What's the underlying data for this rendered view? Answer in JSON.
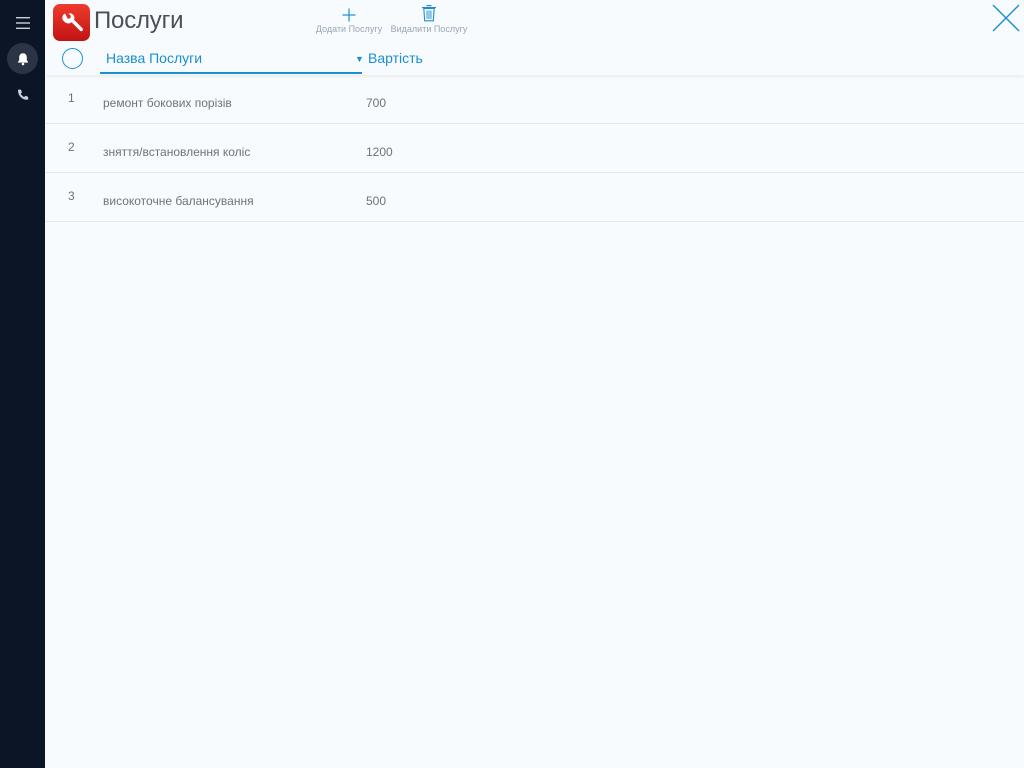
{
  "sidebar": {
    "items": [
      {
        "icon": "menu-icon"
      },
      {
        "icon": "bell-icon",
        "active": true
      },
      {
        "icon": "phone-icon"
      }
    ]
  },
  "header": {
    "app_icon": "wrench-icon",
    "title": "Послуги",
    "add_label": "Додати Послугу",
    "delete_label": "Видалити Послугу"
  },
  "columns": {
    "name": "Назва Послуги",
    "price": "Вартість"
  },
  "services": [
    {
      "num": "1",
      "name": "ремонт бокових порізів",
      "price": "700"
    },
    {
      "num": "2",
      "name": "зняття/встановлення коліс",
      "price": "1200"
    },
    {
      "num": "3",
      "name": "високоточне балансування",
      "price": "500"
    }
  ],
  "colors": {
    "accent": "#1a8fd0",
    "sidebar": "#0b1526",
    "app_icon": "#e0261c"
  }
}
